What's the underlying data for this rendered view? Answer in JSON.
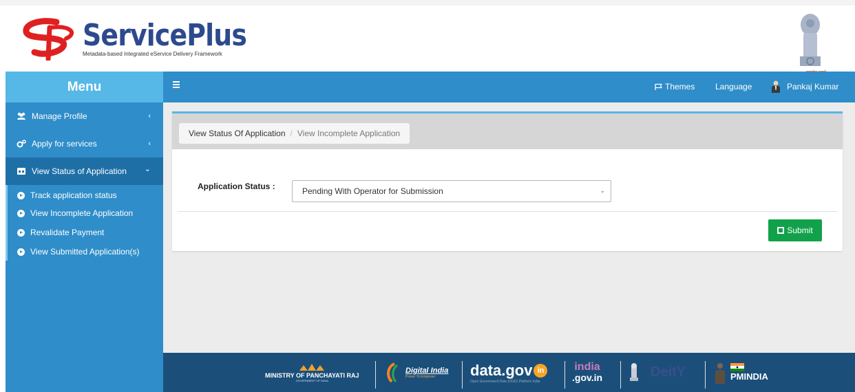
{
  "header": {
    "brand_name": "ServicePlus",
    "tagline": "Metadata-based Integrated eService Delivery Framework",
    "emblem_caption": "सत्यमेव जयते"
  },
  "topbar": {
    "menu_label": "Menu",
    "themes_label": "Themes",
    "language_label": "Language",
    "user_name": "Pankaj Kumar"
  },
  "sidebar": {
    "items": [
      {
        "label": "Manage Profile",
        "icon": "users-icon",
        "chevron": "‹"
      },
      {
        "label": "Apply for services",
        "icon": "gears-icon",
        "chevron": "‹"
      },
      {
        "label": "View Status of Application",
        "icon": "window-icon",
        "chevron": "⌄"
      }
    ],
    "sub_items": [
      {
        "label": "Track application status"
      },
      {
        "label": "View Incomplete Application"
      },
      {
        "label": "Revalidate Payment"
      },
      {
        "label": "View Submitted Application(s)"
      }
    ]
  },
  "main": {
    "breadcrumb": {
      "first": "View Status Of Application",
      "separator": "/",
      "second": "View Incomplete Application"
    },
    "form": {
      "status_label": "Application Status :",
      "status_value": "Pending With Operator for Submission"
    },
    "submit_label": "Submit"
  },
  "footer": {
    "logos": [
      {
        "text": "MINISTRY OF PANCHAYATI RAJ",
        "subtext": "GOVERNMENT OF INDIA"
      },
      {
        "text": "Digital India",
        "subtext": "Power To Empower"
      },
      {
        "text": "data.gov",
        "badge": "in",
        "subtext": "Open Government Data (OGD) Platform India"
      },
      {
        "text": "india",
        "suffix": ".gov.in"
      },
      {
        "text": "DeitY"
      },
      {
        "text": "PMINDIA"
      }
    ]
  },
  "colors": {
    "sidebar_bg": "#2f8dc9",
    "menu_title_bg": "#55b8e6",
    "footer_bg": "#1b4f7a",
    "submit_bg": "#12a14b",
    "brand_blue": "#2d4a8e",
    "brand_red": "#e02020"
  }
}
